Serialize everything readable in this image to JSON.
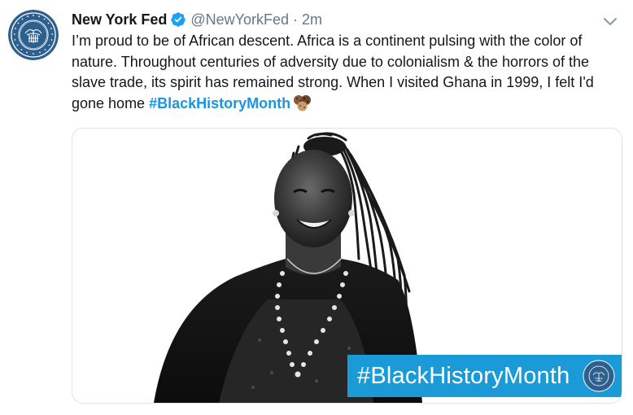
{
  "tweet": {
    "account": {
      "display_name": "New York Fed",
      "handle": "@NewYorkFed",
      "separator": "·",
      "time": "2m",
      "verified": true,
      "avatar_seal_text": "FEDERAL RESERVE BANK OF NEW YORK"
    },
    "text_main": "I’m proud to be of African descent. Africa is a continent pulsing with the color of nature. Throughout centuries of adversity due to colonialism & the horrors of the slave trade, its spirit has remained strong. When I visited Ghana in 1999, I felt I'd gone home ",
    "hashtag": "#BlackHistoryMonth",
    "emoji": "three-cookies",
    "media": {
      "banner_text": "#BlackHistoryMonth",
      "banner_color": "#1a9ad6"
    }
  },
  "colors": {
    "text": "#14171a",
    "secondary": "#657786",
    "link": "#1b95e0",
    "verified": "#1da1f2",
    "seal_blue": "#2d5f8f"
  }
}
